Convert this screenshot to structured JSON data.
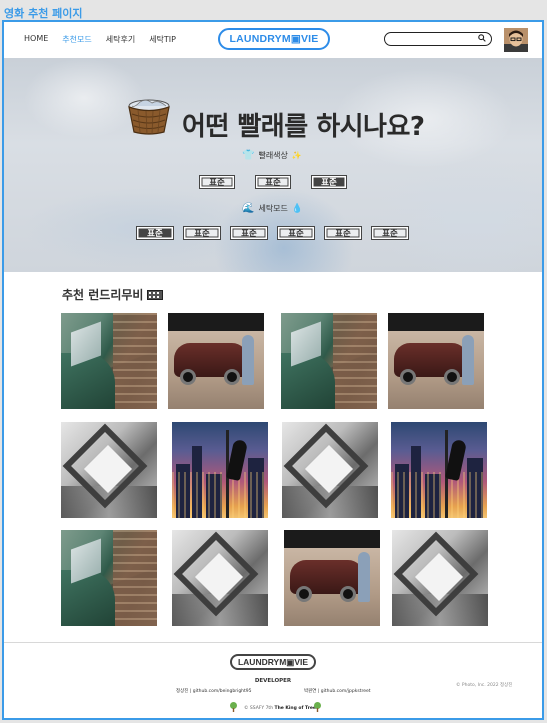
{
  "frame": {
    "label": "영화 추천 페이지"
  },
  "nav": {
    "items": [
      {
        "label": "HOME",
        "active": false
      },
      {
        "label": "추천모드",
        "active": true
      },
      {
        "label": "세탁후기",
        "active": false
      },
      {
        "label": "세탁TIP",
        "active": false
      }
    ],
    "logo": "LAUNDRYM▣VIE"
  },
  "search": {
    "value": "",
    "placeholder": "",
    "icon": "search-icon"
  },
  "avatar": {
    "icon": "user-avatar"
  },
  "hero": {
    "title": "어떤 빨래를 하시나요?",
    "color_section": {
      "label": "빨래색상",
      "options": [
        "표준",
        "표준",
        "표준"
      ],
      "selected_index": 2
    },
    "mode_section": {
      "label": "세탁모드",
      "options": [
        "표준",
        "표준",
        "표준",
        "표준",
        "표준",
        "표준"
      ],
      "selected_index": 0
    }
  },
  "reviews": {
    "title": "추천 런드리무비",
    "posters": [
      "car-green",
      "car-red",
      "car-green",
      "car-red",
      "abstract",
      "city",
      "abstract",
      "city",
      "car-green",
      "abstract",
      "car-red",
      "abstract"
    ]
  },
  "footer": {
    "logo": "LAUNDRYM▣VIE",
    "developer_title": "DEVELOPER",
    "dev1": "정상진 | github.com/beingbright95",
    "dev2": "박원연 | github.com/jppkstreet",
    "copyright": "© Photo, Inc. 2022 정상진",
    "ssafy_prefix": "© SSAFY 7th",
    "ssafy_team": "The King of Tree"
  },
  "colors": {
    "accent": "#3b9be8",
    "logo_blue": "#2d8ce8"
  }
}
